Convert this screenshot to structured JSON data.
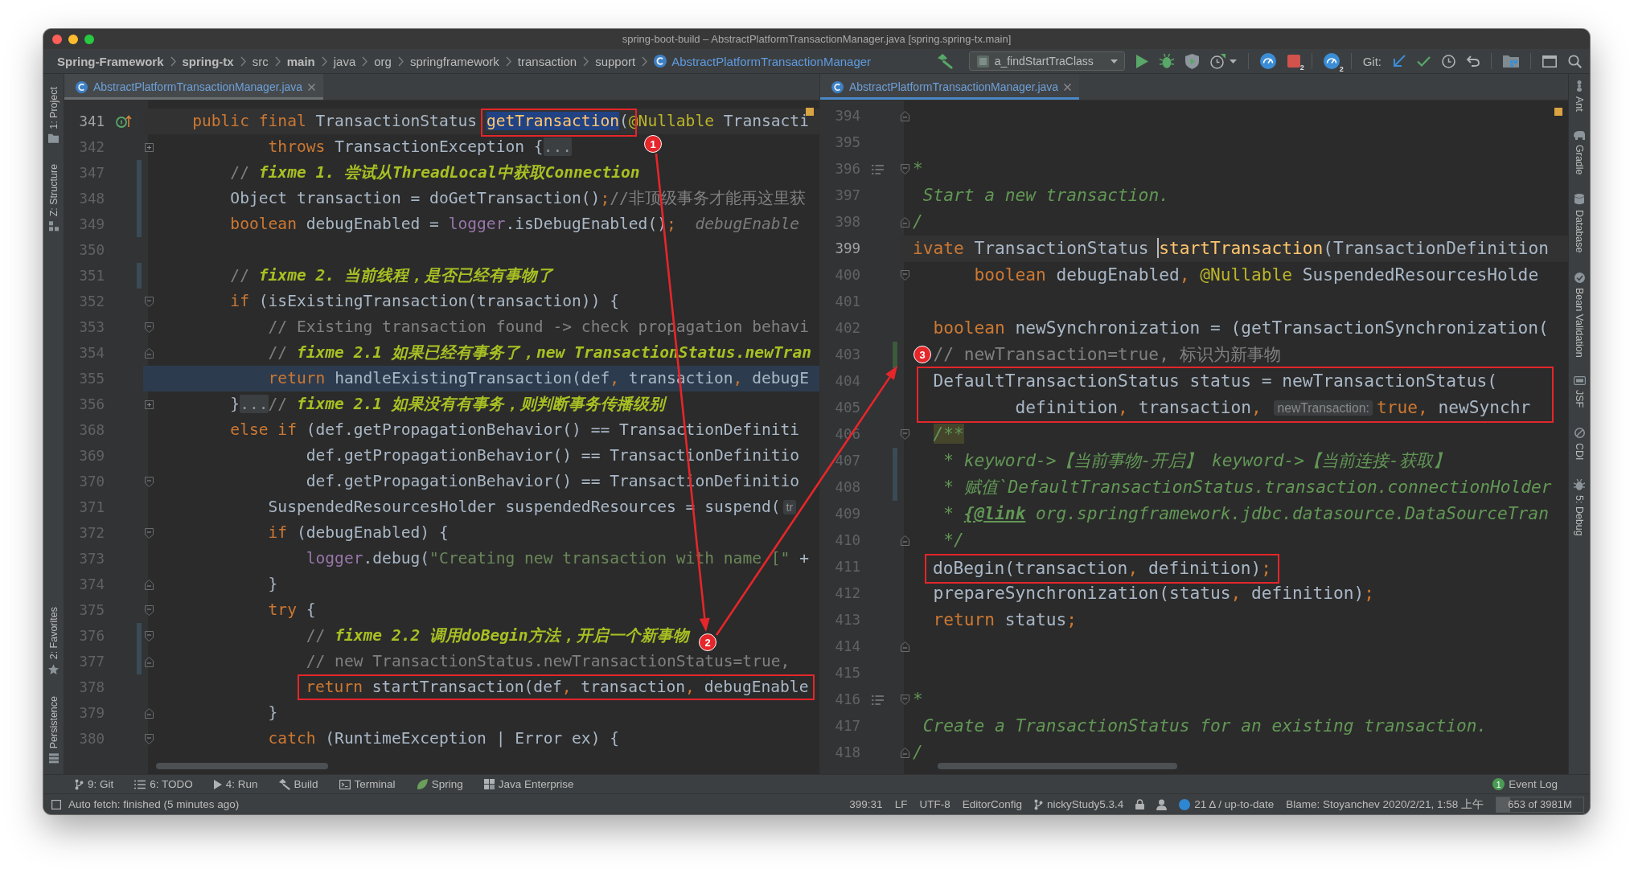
{
  "window": {
    "title": "spring-boot-build – AbstractPlatformTransactionManager.java [spring.spring-tx.main]"
  },
  "nav_bar": {
    "breadcrumbs": [
      {
        "label": "Spring-Framework",
        "kind": "module"
      },
      {
        "label": "spring-tx",
        "kind": "module"
      },
      {
        "label": "src",
        "kind": "folder"
      },
      {
        "label": "main",
        "kind": "module"
      },
      {
        "label": "java",
        "kind": "folder"
      },
      {
        "label": "org",
        "kind": "folder"
      },
      {
        "label": "springframework",
        "kind": "folder"
      },
      {
        "label": "transaction",
        "kind": "folder"
      },
      {
        "label": "support",
        "kind": "folder"
      },
      {
        "label": "AbstractPlatformTransactionManager",
        "kind": "class"
      }
    ],
    "run_config": "a_findStartTraClass",
    "stop_badge": "2",
    "dashboard_badge": "2",
    "git_label": "Git:"
  },
  "left_tool_windows": {
    "top": [
      {
        "label": "1: Project"
      },
      {
        "label": "Z: Structure"
      }
    ],
    "bottom": [
      {
        "label": "2: Favorites"
      },
      {
        "label": "Persistence"
      }
    ]
  },
  "editors": [
    {
      "tab": {
        "label": "AbstractPlatformTransactionManager.java",
        "selected": true,
        "focused": false
      },
      "lines": [
        {
          "number": "341",
          "kind": "caret",
          "gutter_marks": [
            {
              "kind": "override"
            }
          ],
          "tokens": [
            {
              "kind": "keyword",
              "text": "    public final "
            },
            {
              "kind": "plain",
              "text": "TransactionStatus "
            },
            {
              "kind": "decl-selected",
              "text": "getTransaction"
            },
            {
              "kind": "plain",
              "text": "("
            },
            {
              "kind": "annotation",
              "text": "@Nullable"
            },
            {
              "kind": "plain",
              "text": " Transacti"
            }
          ]
        },
        {
          "number": "342",
          "kind": "plain",
          "gutter_marks": [
            {
              "kind": "folded"
            }
          ],
          "tokens": [
            {
              "kind": "keyword",
              "text": "            throws "
            },
            {
              "kind": "plain",
              "text": "TransactionException {"
            },
            {
              "kind": "fold",
              "text": "..."
            }
          ]
        },
        {
          "number": "347",
          "kind": "plain",
          "gutter_marks": [
            {
              "kind": "modified"
            }
          ],
          "tokens": [
            {
              "kind": "comment",
              "text": "        // "
            },
            {
              "kind": "todo",
              "text": "fixme 1. 尝试从ThreadLocal中获取Connection"
            }
          ]
        },
        {
          "number": "348",
          "kind": "plain",
          "gutter_marks": [
            {
              "kind": "modified"
            }
          ],
          "tokens": [
            {
              "kind": "plain",
              "text": "        Object transaction = doGetTransaction()"
            },
            {
              "kind": "keyword",
              "text": ";"
            },
            {
              "kind": "comment",
              "text": "//非顶级事务才能再这里获"
            }
          ]
        },
        {
          "number": "349",
          "kind": "plain",
          "gutter_marks": [
            {
              "kind": "modified"
            }
          ],
          "tokens": [
            {
              "kind": "keyword",
              "text": "        boolean "
            },
            {
              "kind": "plain",
              "text": "debugEnabled = "
            },
            {
              "kind": "field",
              "text": "logger"
            },
            {
              "kind": "plain",
              "text": ".isDebugEnabled()"
            },
            {
              "kind": "keyword",
              "text": ";"
            },
            {
              "kind": "value",
              "text": "  debugEnable"
            }
          ]
        },
        {
          "number": "350",
          "kind": "plain"
        },
        {
          "number": "351",
          "kind": "plain",
          "gutter_marks": [
            {
              "kind": "modified"
            }
          ],
          "tokens": [
            {
              "kind": "comment",
              "text": "        // "
            },
            {
              "kind": "todo",
              "text": "fixme 2. 当前线程，是否已经有事物了"
            }
          ]
        },
        {
          "number": "352",
          "kind": "plain",
          "gutter_marks": [
            {
              "kind": "fold-start"
            }
          ],
          "tokens": [
            {
              "kind": "keyword",
              "text": "        if "
            },
            {
              "kind": "plain",
              "text": "(isExistingTransaction(transaction)) {"
            }
          ]
        },
        {
          "number": "353",
          "kind": "plain",
          "gutter_marks": [
            {
              "kind": "fold-start"
            }
          ],
          "tokens": [
            {
              "kind": "comment",
              "text": "            // Existing transaction found -> check propagation behavi"
            }
          ]
        },
        {
          "number": "354",
          "kind": "plain",
          "gutter_marks": [
            {
              "kind": "fold-end"
            }
          ],
          "tokens": [
            {
              "kind": "comment",
              "text": "            // "
            },
            {
              "kind": "todo",
              "text": "fixme 2.1 如果已经有事务了，new TransactionStatus.newTran"
            }
          ]
        },
        {
          "number": "355",
          "kind": "execution",
          "tokens": [
            {
              "kind": "keyword",
              "text": "            return "
            },
            {
              "kind": "plain",
              "text": "handleExistingTransaction(def"
            },
            {
              "kind": "keyword",
              "text": ", "
            },
            {
              "kind": "plain",
              "text": "transaction"
            },
            {
              "kind": "keyword",
              "text": ", "
            },
            {
              "kind": "plain",
              "text": "debugE"
            }
          ]
        },
        {
          "number": "356",
          "kind": "plain",
          "gutter_marks": [
            {
              "kind": "folded"
            }
          ],
          "tokens": [
            {
              "kind": "plain",
              "text": "        }"
            },
            {
              "kind": "fold",
              "text": "..."
            },
            {
              "kind": "comment",
              "text": "// "
            },
            {
              "kind": "todo",
              "text": "fixme 2.1 如果没有有事务，则判断事务传播级别"
            }
          ]
        },
        {
          "number": "368",
          "kind": "plain",
          "tokens": [
            {
              "kind": "keyword",
              "text": "        else if "
            },
            {
              "kind": "plain",
              "text": "(def.getPropagationBehavior() == TransactionDefiniti"
            }
          ]
        },
        {
          "number": "369",
          "kind": "plain",
          "tokens": [
            {
              "kind": "plain",
              "text": "                def.getPropagationBehavior() == TransactionDefinitio"
            }
          ]
        },
        {
          "number": "370",
          "kind": "plain",
          "gutter_marks": [
            {
              "kind": "fold-start"
            }
          ],
          "tokens": [
            {
              "kind": "plain",
              "text": "                def.getPropagationBehavior() == TransactionDefinitio"
            }
          ]
        },
        {
          "number": "371",
          "kind": "plain",
          "tokens": [
            {
              "kind": "plain",
              "text": "            SuspendedResourcesHolder suspendedResources = suspend("
            },
            {
              "kind": "hint",
              "text": "tr"
            }
          ]
        },
        {
          "number": "372",
          "kind": "plain",
          "gutter_marks": [
            {
              "kind": "fold-start"
            }
          ],
          "tokens": [
            {
              "kind": "keyword",
              "text": "            if "
            },
            {
              "kind": "plain",
              "text": "(debugEnabled) {"
            }
          ]
        },
        {
          "number": "373",
          "kind": "plain",
          "tokens": [
            {
              "kind": "field",
              "text": "                logger"
            },
            {
              "kind": "plain",
              "text": ".debug("
            },
            {
              "kind": "string",
              "text": "\"Creating new transaction with name [\""
            },
            {
              "kind": "plain",
              "text": " +"
            }
          ]
        },
        {
          "number": "374",
          "kind": "plain",
          "gutter_marks": [
            {
              "kind": "fold-end"
            }
          ],
          "tokens": [
            {
              "kind": "plain",
              "text": "            }"
            }
          ]
        },
        {
          "number": "375",
          "kind": "plain",
          "gutter_marks": [
            {
              "kind": "fold-start"
            }
          ],
          "tokens": [
            {
              "kind": "keyword",
              "text": "            try "
            },
            {
              "kind": "plain",
              "text": "{"
            }
          ]
        },
        {
          "number": "376",
          "kind": "plain",
          "gutter_marks": [
            {
              "kind": "modified"
            },
            {
              "kind": "fold-start"
            }
          ],
          "tokens": [
            {
              "kind": "comment",
              "text": "                // "
            },
            {
              "kind": "todo",
              "text": "fixme 2.2 调用doBegin方法，开启一个新事物"
            }
          ]
        },
        {
          "number": "377",
          "kind": "plain",
          "gutter_marks": [
            {
              "kind": "modified"
            },
            {
              "kind": "fold-end"
            }
          ],
          "tokens": [
            {
              "kind": "comment",
              "text": "                // new TransactionStatus.newTransactionStatus=true,"
            }
          ]
        },
        {
          "number": "378",
          "kind": "plain",
          "tokens": [
            {
              "kind": "keyword",
              "text": "                return "
            },
            {
              "kind": "plain",
              "text": "startTransaction(def"
            },
            {
              "kind": "keyword",
              "text": ", "
            },
            {
              "kind": "plain",
              "text": "transaction"
            },
            {
              "kind": "keyword",
              "text": ", "
            },
            {
              "kind": "plain",
              "text": "debugEnable"
            }
          ]
        },
        {
          "number": "379",
          "kind": "plain",
          "gutter_marks": [
            {
              "kind": "fold-end"
            }
          ],
          "tokens": [
            {
              "kind": "plain",
              "text": "            }"
            }
          ]
        },
        {
          "number": "380",
          "kind": "plain",
          "gutter_marks": [
            {
              "kind": "fold-start"
            }
          ],
          "tokens": [
            {
              "kind": "keyword",
              "text": "            catch "
            },
            {
              "kind": "plain",
              "text": "(RuntimeException | Error ex) {"
            }
          ]
        }
      ]
    },
    {
      "tab": {
        "label": "AbstractPlatformTransactionManager.java",
        "selected": true,
        "focused": true
      },
      "lines": [
        {
          "number": "394",
          "kind": "plain",
          "gutter_marks": [
            {
              "kind": "fold-end"
            }
          ]
        },
        {
          "number": "395",
          "kind": "plain"
        },
        {
          "number": "396",
          "kind": "plain",
          "gutter_marks": [
            {
              "kind": "doc"
            },
            {
              "kind": "fold-start"
            }
          ],
          "tokens": [
            {
              "kind": "doc",
              "text": "*"
            }
          ]
        },
        {
          "number": "397",
          "kind": "plain",
          "tokens": [
            {
              "kind": "doc",
              "text": " Start a new transaction."
            }
          ]
        },
        {
          "number": "398",
          "kind": "plain",
          "gutter_marks": [
            {
              "kind": "fold-end"
            }
          ],
          "tokens": [
            {
              "kind": "doc",
              "text": "/"
            }
          ]
        },
        {
          "number": "399",
          "kind": "caret",
          "tokens": [
            {
              "kind": "keyword",
              "text": "ivate "
            },
            {
              "kind": "plain",
              "text": "TransactionStatus "
            },
            {
              "kind": "decl-caret",
              "text": "startTransaction"
            },
            {
              "kind": "plain",
              "text": "(TransactionDefinition"
            }
          ]
        },
        {
          "number": "400",
          "kind": "plain",
          "gutter_marks": [
            {
              "kind": "fold-start"
            }
          ],
          "tokens": [
            {
              "kind": "keyword",
              "text": "      boolean "
            },
            {
              "kind": "plain",
              "text": "debugEnabled"
            },
            {
              "kind": "keyword",
              "text": ", "
            },
            {
              "kind": "annotation",
              "text": "@Nullable "
            },
            {
              "kind": "plain",
              "text": "SuspendedResourcesHolde"
            }
          ]
        },
        {
          "number": "401",
          "kind": "plain"
        },
        {
          "number": "402",
          "kind": "plain",
          "tokens": [
            {
              "kind": "keyword",
              "text": "  boolean "
            },
            {
              "kind": "plain",
              "text": "newSynchronization = (getTransactionSynchronization("
            }
          ]
        },
        {
          "number": "403",
          "kind": "plain",
          "gutter_marks": [
            {
              "kind": "added"
            }
          ],
          "tokens": [
            {
              "kind": "comment",
              "text": "  // newTransaction=true, 标识为新事物"
            }
          ]
        },
        {
          "number": "404",
          "kind": "plain",
          "tokens": [
            {
              "kind": "plain",
              "text": "  DefaultTransactionStatus status = newTransactionStatus("
            }
          ]
        },
        {
          "number": "405",
          "kind": "plain",
          "tokens": [
            {
              "kind": "plain",
              "text": "          definition"
            },
            {
              "kind": "keyword",
              "text": ", "
            },
            {
              "kind": "plain",
              "text": "transaction"
            },
            {
              "kind": "keyword",
              "text": ", "
            },
            {
              "kind": "hint",
              "text": "newTransaction:"
            },
            {
              "kind": "keyword",
              "text": "true, "
            },
            {
              "kind": "plain",
              "text": "newSynchr"
            }
          ]
        },
        {
          "number": "406",
          "kind": "plain",
          "gutter_marks": [
            {
              "kind": "fold-start"
            }
          ],
          "tokens": [
            {
              "kind": "doc-hl",
              "text": "  /**"
            }
          ]
        },
        {
          "number": "407",
          "kind": "plain",
          "gutter_marks": [
            {
              "kind": "modified"
            }
          ],
          "tokens": [
            {
              "kind": "doc",
              "text": "   * keyword->【当前事物-开启】 keyword->【当前连接-获取】"
            }
          ]
        },
        {
          "number": "408",
          "kind": "plain",
          "gutter_marks": [
            {
              "kind": "modified"
            }
          ],
          "tokens": [
            {
              "kind": "doc",
              "text": "   * 赋值`DefaultTransactionStatus.transaction.connectionHolder"
            }
          ]
        },
        {
          "number": "409",
          "kind": "plain",
          "tokens": [
            {
              "kind": "doc",
              "text": "   * "
            },
            {
              "kind": "doc-tag",
              "text": "{@link"
            },
            {
              "kind": "doc",
              "text": " org.springframework.jdbc.datasource.DataSourceTran"
            }
          ]
        },
        {
          "number": "410",
          "kind": "plain",
          "gutter_marks": [
            {
              "kind": "fold-end"
            }
          ],
          "tokens": [
            {
              "kind": "doc",
              "text": "   */"
            }
          ]
        },
        {
          "number": "411",
          "kind": "plain",
          "tokens": [
            {
              "kind": "plain",
              "text": "  doBegin(transaction"
            },
            {
              "kind": "keyword",
              "text": ", "
            },
            {
              "kind": "plain",
              "text": "definition)"
            },
            {
              "kind": "keyword",
              "text": ";"
            }
          ]
        },
        {
          "number": "412",
          "kind": "plain",
          "tokens": [
            {
              "kind": "plain",
              "text": "  prepareSynchronization(status"
            },
            {
              "kind": "keyword",
              "text": ", "
            },
            {
              "kind": "plain",
              "text": "definition)"
            },
            {
              "kind": "keyword",
              "text": ";"
            }
          ]
        },
        {
          "number": "413",
          "kind": "plain",
          "tokens": [
            {
              "kind": "keyword",
              "text": "  return "
            },
            {
              "kind": "plain",
              "text": "status"
            },
            {
              "kind": "keyword",
              "text": ";"
            }
          ]
        },
        {
          "number": "414",
          "kind": "plain",
          "gutter_marks": [
            {
              "kind": "fold-end"
            }
          ]
        },
        {
          "number": "415",
          "kind": "plain"
        },
        {
          "number": "416",
          "kind": "plain",
          "gutter_marks": [
            {
              "kind": "doc"
            },
            {
              "kind": "fold-start"
            }
          ],
          "tokens": [
            {
              "kind": "doc",
              "text": "*"
            }
          ]
        },
        {
          "number": "417",
          "kind": "plain",
          "tokens": [
            {
              "kind": "doc",
              "text": " Create a TransactionStatus for an existing transaction."
            }
          ]
        },
        {
          "number": "418",
          "kind": "plain",
          "gutter_marks": [
            {
              "kind": "fold-end"
            }
          ],
          "tokens": [
            {
              "kind": "doc",
              "text": "/"
            }
          ]
        }
      ]
    }
  ],
  "right_tool_windows": [
    {
      "label": "Ant"
    },
    {
      "label": "Gradle"
    },
    {
      "label": "Database"
    },
    {
      "label": "Bean Validation"
    },
    {
      "label": "JSF"
    },
    {
      "label": "CDI"
    },
    {
      "label": "5: Debug"
    }
  ],
  "annotations": [
    {
      "label": "1"
    },
    {
      "label": "2"
    },
    {
      "label": "3"
    }
  ],
  "bottom_tool_windows": [
    {
      "label": "9: Git"
    },
    {
      "label": "6: TODO"
    },
    {
      "label": "4: Run"
    },
    {
      "label": "Build"
    },
    {
      "label": "Terminal"
    },
    {
      "label": "Spring"
    },
    {
      "label": "Java Enterprise"
    }
  ],
  "event_log": {
    "label": "Event Log",
    "count": "1"
  },
  "status_bar": {
    "message": "Auto fetch: finished (5 minutes ago)",
    "caret_position": "399:31",
    "line_separator": "LF",
    "encoding": "UTF-8",
    "code_style": "EditorConfig",
    "branch": "nickyStudy5.3.4",
    "vcs_status": "21 Δ / up-to-date",
    "blame": "Blame: Stoyanchev 2020/2/21, 1:58 上午",
    "memory": {
      "label": "653 of 3981M",
      "level": 0.16
    }
  }
}
